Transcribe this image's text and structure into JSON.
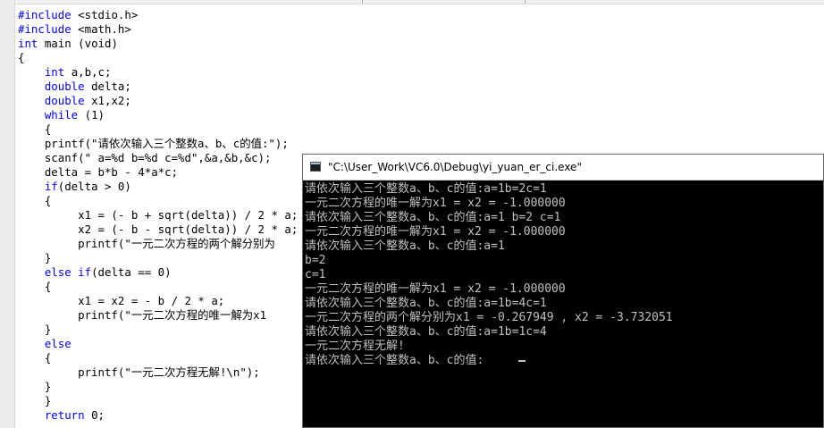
{
  "editor": {
    "lines": [
      [
        {
          "t": "#include",
          "k": 1
        },
        {
          "t": " <stdio.h>"
        }
      ],
      [
        {
          "t": "#include",
          "k": 1
        },
        {
          "t": " <math.h>"
        }
      ],
      [
        {
          "t": "int",
          "k": 1
        },
        {
          "t": " main (void)"
        }
      ],
      [
        {
          "t": "{"
        }
      ],
      [
        {
          "t": "    "
        },
        {
          "t": "int",
          "k": 1
        },
        {
          "t": " a,b,c;"
        }
      ],
      [
        {
          "t": "    "
        },
        {
          "t": "double",
          "k": 1
        },
        {
          "t": " delta;"
        }
      ],
      [
        {
          "t": "    "
        },
        {
          "t": "double",
          "k": 1
        },
        {
          "t": " x1,x2;"
        }
      ],
      [
        {
          "t": "    "
        },
        {
          "t": "while",
          "k": 1
        },
        {
          "t": " (1)"
        }
      ],
      [
        {
          "t": "    {"
        }
      ],
      [
        {
          "t": "    printf(\"请依次输入三个整数a、b、c的值:\");"
        }
      ],
      [
        {
          "t": "    scanf(\" a=%d b=%d c=%d\",&a,&b,&c);"
        }
      ],
      [
        {
          "t": "    delta = b*b - 4*a*c;"
        }
      ],
      [
        {
          "t": "    "
        },
        {
          "t": "if",
          "k": 1
        },
        {
          "t": "(delta > 0)"
        }
      ],
      [
        {
          "t": "    {"
        }
      ],
      [
        {
          "t": "         x1 = (- b + sqrt(delta)) / 2 * a;"
        }
      ],
      [
        {
          "t": "         x2 = (- b - sqrt(delta)) / 2 * a;"
        }
      ],
      [
        {
          "t": "         printf(\"一元二次方程的两个解分别为"
        }
      ],
      [
        {
          "t": "    }"
        }
      ],
      [
        {
          "t": "    "
        },
        {
          "t": "else if",
          "k": 1
        },
        {
          "t": "(delta == 0)"
        }
      ],
      [
        {
          "t": "    {"
        }
      ],
      [
        {
          "t": "         x1 = x2 = - b / 2 * a;"
        }
      ],
      [
        {
          "t": "         printf(\"一元二次方程的唯一解为x1"
        }
      ],
      [
        {
          "t": "    }"
        }
      ],
      [
        {
          "t": "    "
        },
        {
          "t": "else",
          "k": 1
        }
      ],
      [
        {
          "t": "    {"
        }
      ],
      [
        {
          "t": "         printf(\"一元二次方程无解!\\n\");"
        }
      ],
      [
        {
          "t": "    }"
        }
      ],
      [
        {
          "t": "    }"
        }
      ],
      [
        {
          "t": "    "
        },
        {
          "t": "return",
          "k": 1
        },
        {
          "t": " 0;"
        }
      ]
    ]
  },
  "console": {
    "title": "\"C:\\User_Work\\VC6.0\\Debug\\yi_yuan_er_ci.exe\"",
    "lines": [
      "请依次输入三个整数a、b、c的值:a=1b=2c=1",
      "一元二次方程的唯一解为x1 = x2 = -1.000000",
      "请依次输入三个整数a、b、c的值:a=1 b=2 c=1",
      "一元二次方程的唯一解为x1 = x2 = -1.000000",
      "请依次输入三个整数a、b、c的值:a=1",
      "b=2",
      "c=1",
      "一元二次方程的唯一解为x1 = x2 = -1.000000",
      "请依次输入三个整数a、b、c的值:a=1b=4c=1",
      "一元二次方程的两个解分别为x1 = -0.267949 , x2 = -3.732051",
      "请依次输入三个整数a、b、c的值:a=1b=1c=4",
      "一元二次方程无解!",
      "请依次输入三个整数a、b、c的值:"
    ]
  },
  "colors": {
    "keyword": "#0000ff",
    "console_bg": "#000000",
    "console_text": "#c0c0c0"
  }
}
